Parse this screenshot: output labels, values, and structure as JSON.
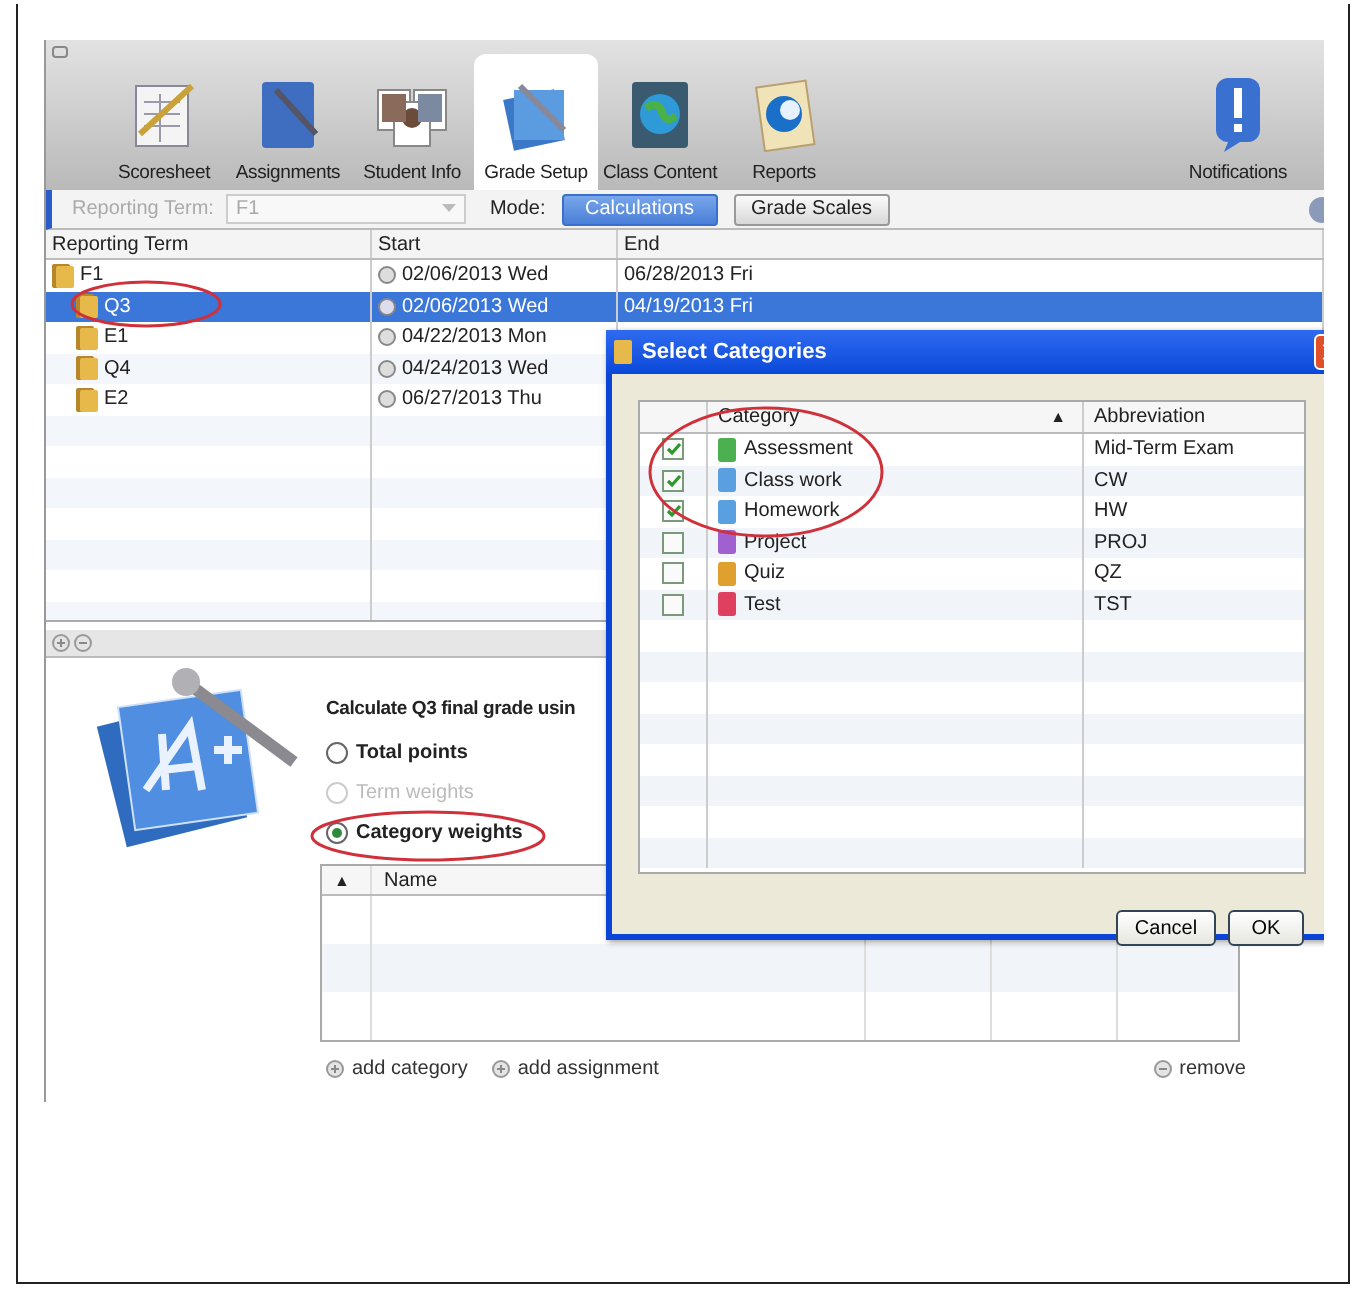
{
  "toolbar": {
    "tabs": [
      {
        "label": "Scoresheet",
        "selected": false
      },
      {
        "label": "Assignments",
        "selected": false
      },
      {
        "label": "Student Info",
        "selected": false
      },
      {
        "label": "Grade Setup",
        "selected": true
      },
      {
        "label": "Class Content",
        "selected": false
      },
      {
        "label": "Reports",
        "selected": false
      }
    ],
    "notifications": {
      "label": "Notifications"
    }
  },
  "subbar": {
    "reporting_term": {
      "label": "Reporting Term:",
      "value": "F1",
      "disabled": true
    },
    "mode_label": "Mode:",
    "modes": [
      {
        "label": "Calculations",
        "selected": true
      },
      {
        "label": "Grade Scales",
        "selected": false
      }
    ]
  },
  "terms_table": {
    "columns": [
      "Reporting Term",
      "Start",
      "End"
    ],
    "rows": [
      {
        "term": "F1",
        "start": "02/06/2013 Wed",
        "end": "06/28/2013 Fri",
        "selected": false,
        "children": [
          {
            "term": "Q3",
            "start": "02/06/2013 Wed",
            "end": "04/19/2013 Fri",
            "selected": true
          },
          {
            "term": "E1",
            "start": "04/22/2013 Mon",
            "selected": false
          },
          {
            "term": "Q4",
            "start": "04/24/2013 Wed",
            "selected": false
          },
          {
            "term": "E2",
            "start": "06/27/2013 Thu",
            "selected": false
          }
        ]
      }
    ]
  },
  "calculation": {
    "prompt": "Calculate Q3 final grade usin",
    "methods": [
      {
        "label": "Total points",
        "selected": false,
        "disabled": false
      },
      {
        "label": "Term weights",
        "selected": false,
        "disabled": true
      },
      {
        "label": "Category weights",
        "selected": true,
        "disabled": false
      }
    ],
    "weights_table": {
      "sort_mark": "▲",
      "columns": [
        "Name"
      ]
    },
    "actions": [
      {
        "label": "add category",
        "kind": "add"
      },
      {
        "label": "add assignment",
        "kind": "add"
      },
      {
        "label": "remove",
        "kind": "remove"
      }
    ]
  },
  "dialog": {
    "title": "Select Categories",
    "sort_mark": "▲",
    "columns": [
      "Category",
      "Abbreviation"
    ],
    "rows": [
      {
        "category": "Assessment",
        "abbreviation": "Mid-Term Exam",
        "checked": true,
        "color": "#4caf50"
      },
      {
        "category": "Class work",
        "abbreviation": "CW",
        "checked": true,
        "color": "#5aa0e0"
      },
      {
        "category": "Homework",
        "abbreviation": "HW",
        "checked": true,
        "color": "#5aa0e0"
      },
      {
        "category": "Project",
        "abbreviation": "PROJ",
        "checked": false,
        "color": "#a060d0"
      },
      {
        "category": "Quiz",
        "abbreviation": "QZ",
        "checked": false,
        "color": "#e0a030"
      },
      {
        "category": "Test",
        "abbreviation": "TST",
        "checked": false,
        "color": "#e04060"
      }
    ],
    "buttons": [
      "Cancel",
      "OK"
    ]
  }
}
